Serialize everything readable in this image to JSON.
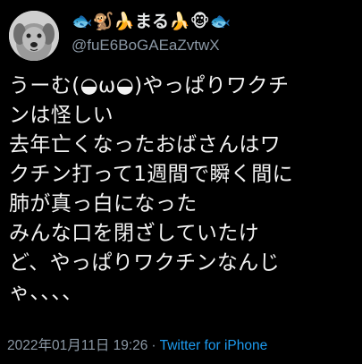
{
  "author": {
    "display_name": "🐟🐒🍌まる🍌🐵🐟",
    "handle": "@fuE6BoGAEaZvtwX",
    "avatar_icon": "dog-avatar"
  },
  "tweet": {
    "lines": [
      "うーむ(◒ω◒)やっぱりワクチ",
      "ンは怪しい",
      "去年亡くなったおばさんはワ",
      "クチン打って1週間で瞬く間に",
      "肺が真っ白になった",
      "みんな口を閉ざしていたけ",
      "ど、やっぱりワクチンなんじ",
      "ゃ、、、、"
    ]
  },
  "meta": {
    "timestamp": "2022年01月11日 19:26",
    "separator": "·",
    "source": "Twitter for iPhone"
  },
  "colors": {
    "background": "#000000",
    "text": "#e7e9ea",
    "muted": "#8b98a5",
    "link": "#1d9bf0"
  }
}
